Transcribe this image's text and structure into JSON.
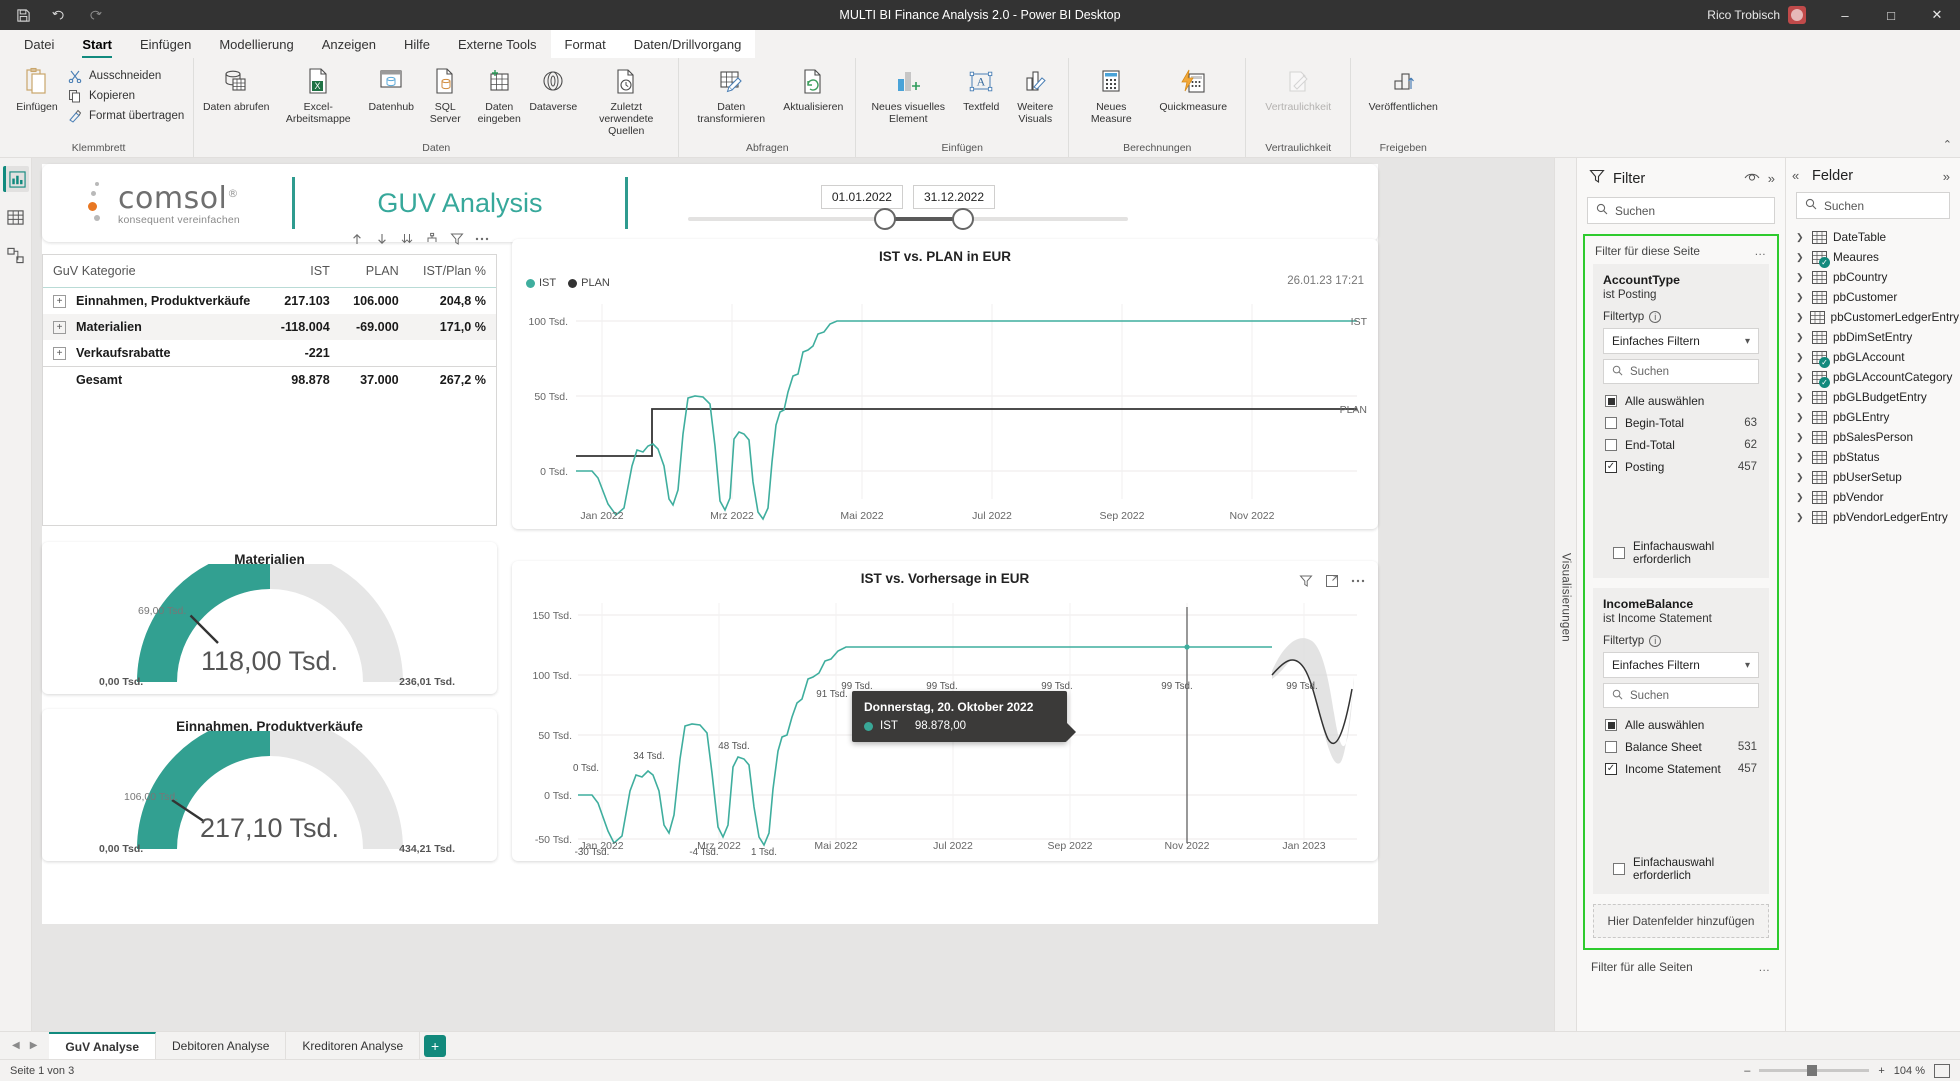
{
  "titlebar": {
    "app_title": "MULTI BI Finance Analysis 2.0 - Power BI Desktop",
    "user": "Rico Trobisch",
    "icons": [
      "save-icon",
      "undo-icon",
      "redo-icon"
    ],
    "window_buttons": {
      "minimize": "–",
      "maximize": "□",
      "close": "✕"
    }
  },
  "menu": {
    "tabs": [
      {
        "label": "Datei",
        "active": false
      },
      {
        "label": "Start",
        "active": true
      },
      {
        "label": "Einfügen",
        "active": false
      },
      {
        "label": "Modellierung",
        "active": false
      },
      {
        "label": "Anzeigen",
        "active": false
      },
      {
        "label": "Hilfe",
        "active": false
      },
      {
        "label": "Externe Tools",
        "active": false
      }
    ],
    "context_tabs": [
      {
        "label": "Format"
      },
      {
        "label": "Daten/Drillvorgang"
      }
    ]
  },
  "ribbon": {
    "groups": [
      {
        "label": "Klemmbrett",
        "paste": "Einfügen",
        "items": [
          {
            "label": "Ausschneiden",
            "icon": "scissors-icon"
          },
          {
            "label": "Kopieren",
            "icon": "copy-icon"
          },
          {
            "label": "Format übertragen",
            "icon": "format-painter-icon"
          }
        ]
      },
      {
        "label": "Daten",
        "items": [
          {
            "label": "Daten abrufen",
            "icon": "get-data-icon",
            "dropdown": true
          },
          {
            "label": "Excel-Arbeitsmappe",
            "icon": "excel-icon"
          },
          {
            "label": "Datenhub",
            "icon": "datahub-icon",
            "dropdown": true
          },
          {
            "label": "SQL Server",
            "icon": "sql-server-icon"
          },
          {
            "label": "Daten eingeben",
            "icon": "enter-data-icon"
          },
          {
            "label": "Dataverse",
            "icon": "dataverse-icon"
          },
          {
            "label": "Zuletzt verwendete Quellen",
            "icon": "recent-sources-icon",
            "dropdown": true
          }
        ]
      },
      {
        "label": "Abfragen",
        "items": [
          {
            "label": "Daten transformieren",
            "icon": "transform-data-icon",
            "dropdown": true
          },
          {
            "label": "Aktualisieren",
            "icon": "refresh-icon"
          }
        ]
      },
      {
        "label": "Einfügen",
        "items": [
          {
            "label": "Neues visuelles Element",
            "icon": "new-visual-icon"
          },
          {
            "label": "Textfeld",
            "icon": "textbox-icon"
          },
          {
            "label": "Weitere Visuals",
            "icon": "more-visuals-icon",
            "dropdown": true
          }
        ]
      },
      {
        "label": "Berechnungen",
        "items": [
          {
            "label": "Neues Measure",
            "icon": "new-measure-icon"
          },
          {
            "label": "Quickmeasure",
            "icon": "quick-measure-icon"
          }
        ]
      },
      {
        "label": "Vertraulichkeit",
        "items": [
          {
            "label": "Vertraulichkeit",
            "icon": "sensitivity-icon",
            "dropdown": true,
            "disabled": true
          }
        ]
      },
      {
        "label": "Freigeben",
        "items": [
          {
            "label": "Veröffentlichen",
            "icon": "publish-icon"
          }
        ]
      }
    ]
  },
  "left_rail": {
    "items": [
      {
        "name": "report-view",
        "icon": "report-icon",
        "active": true
      },
      {
        "name": "data-view",
        "icon": "table-icon",
        "active": false
      },
      {
        "name": "model-view",
        "icon": "model-icon",
        "active": false
      }
    ]
  },
  "report": {
    "logo": {
      "main": "comsol",
      "registered": "®",
      "sub": "konsequent vereinfachen"
    },
    "title": "GUV Analysis",
    "slicer": {
      "start_date": "01.01.2022",
      "end_date": "31.12.2022"
    },
    "matrix": {
      "columns": [
        "GuV Kategorie",
        "IST",
        "PLAN",
        "IST/Plan %"
      ],
      "rows": [
        {
          "label": "Einnahmen, Produktverkäufe",
          "ist": "217.103",
          "plan": "106.000",
          "pct": "204,8 %",
          "expandable": true
        },
        {
          "label": "Materialien",
          "ist": "-118.004",
          "plan": "-69.000",
          "pct": "171,0 %",
          "expandable": true
        },
        {
          "label": "Verkaufsrabatte",
          "ist": "-221",
          "plan": "",
          "pct": "",
          "expandable": true
        },
        {
          "label": "Gesamt",
          "ist": "98.878",
          "plan": "37.000",
          "pct": "267,2 %",
          "expandable": false
        }
      ]
    },
    "gauges": [
      {
        "title": "Materialien",
        "value": "118,00 Tsd.",
        "min": "0,00 Tsd.",
        "max": "236,01 Tsd.",
        "target": "69,00 Tsd.",
        "fill_fraction": 0.4999,
        "target_fraction": 0.2923
      },
      {
        "title": "Einnahmen, Produktverkäufe",
        "value": "217,10 Tsd.",
        "min": "0,00 Tsd.",
        "max": "434,21 Tsd.",
        "target": "106,00 Tsd.",
        "fill_fraction": 0.4999,
        "target_fraction": 0.2441
      }
    ]
  },
  "chart_data": [
    {
      "type": "line",
      "title": "IST vs. PLAN in EUR",
      "timestamp": "26.01.23 17:21",
      "legend": [
        {
          "name": "IST",
          "color": "#3fae9e"
        },
        {
          "name": "PLAN",
          "color": "#333333"
        }
      ],
      "legend_position": "top-left",
      "xlabel": "",
      "ylabel": "",
      "ylim": [
        -20000,
        110000
      ],
      "yticks": [
        "0 Tsd.",
        "50 Tsd.",
        "100 Tsd."
      ],
      "ytick_values": [
        0,
        50000,
        100000
      ],
      "xticks": [
        "Jan 2022",
        "Mrz 2022",
        "Mai 2022",
        "Jul 2022",
        "Sep 2022",
        "Nov 2022"
      ],
      "grid": true,
      "series": [
        {
          "name": "IST",
          "color": "#3fae9e",
          "end_label": "IST",
          "values": [
            0,
            0,
            -2000,
            -30000,
            -18000,
            8000,
            0,
            12000,
            -4000,
            46000,
            48000,
            1000,
            0,
            -20000,
            28000,
            60000,
            70000,
            78000,
            96000,
            99000,
            99000,
            99000,
            99000,
            99000,
            99000,
            99000,
            99000,
            99000,
            99000,
            99000,
            99000,
            99000
          ]
        },
        {
          "name": "PLAN",
          "color": "#333333",
          "end_label": "PLAN",
          "values": [
            10000,
            10000,
            10000,
            10000,
            37000,
            37000,
            37000,
            37000,
            37000,
            37000,
            37000,
            37000,
            37000,
            37000,
            37000,
            37000,
            37000,
            37000,
            37000,
            37000,
            37000,
            37000,
            37000,
            37000,
            37000,
            37000,
            37000,
            37000,
            37000,
            37000,
            37000,
            37000
          ]
        }
      ]
    },
    {
      "type": "line",
      "title": "IST vs. Vorhersage in EUR",
      "xlabel": "",
      "ylabel": "",
      "ylim": [
        -60000,
        160000
      ],
      "yticks": [
        "-50 Tsd.",
        "0 Tsd.",
        "50 Tsd.",
        "100 Tsd.",
        "150 Tsd."
      ],
      "ytick_values": [
        -50000,
        0,
        50000,
        100000,
        150000
      ],
      "xticks": [
        "Jan 2022",
        "Mrz 2022",
        "Mai 2022",
        "Jul 2022",
        "Sep 2022",
        "Nov 2022",
        "Jan 2023"
      ],
      "grid": true,
      "data_labels": [
        "0 Tsd.",
        "-30 Tsd.",
        "34 Tsd.",
        "-4 Tsd.",
        "48 Tsd.",
        "1 Tsd.",
        "91 Tsd.",
        "99 Tsd.",
        "99 Tsd.",
        "99 Tsd.",
        "99 Tsd.",
        "99 Tsd."
      ],
      "forecast_band": true,
      "series": [
        {
          "name": "IST",
          "color": "#3fae9e",
          "values": [
            0,
            0,
            -10000,
            -30000,
            -14000,
            10000,
            2000,
            34000,
            -4000,
            48000,
            44000,
            1000,
            -2000,
            20000,
            48000,
            62000,
            78000,
            91000,
            99000,
            99000,
            99000,
            99000,
            99000,
            99000,
            99000,
            99000,
            99000,
            99000
          ]
        },
        {
          "name": "Vorhersage",
          "color": "#333333",
          "values": [
            99000,
            99000,
            60000,
            85000,
            110000,
            99000
          ]
        }
      ],
      "tooltip": {
        "title": "Donnerstag, 20. Oktober 2022",
        "series_name": "IST",
        "value": "98.878,00",
        "dot_color": "#3fae9e"
      },
      "toolbar_icons": [
        "filter-icon",
        "focus-mode-icon",
        "more-options-icon"
      ]
    }
  ],
  "visualizations_strip": {
    "label": "Visualisierungen"
  },
  "filter_pane": {
    "title": "Filter",
    "search_placeholder": "Suchen",
    "header_icons": [
      "eye-icon",
      "collapse-pane-icon"
    ],
    "section_label": "Filter für diese Seite",
    "cards": [
      {
        "name": "AccountType",
        "condition": "ist Posting",
        "filter_type_label": "Filtertyp",
        "filter_type_value": "Einfaches Filtern",
        "search_placeholder": "Suchen",
        "select_all_label": "Alle auswählen",
        "select_all_state": "partial",
        "items": [
          {
            "label": "Begin-Total",
            "count": "63",
            "checked": false
          },
          {
            "label": "End-Total",
            "count": "62",
            "checked": false
          },
          {
            "label": "Posting",
            "count": "457",
            "checked": true
          }
        ],
        "single_select_label": "Einfachauswahl erforderlich",
        "single_select_checked": false
      },
      {
        "name": "IncomeBalance",
        "condition": "ist Income Statement",
        "filter_type_label": "Filtertyp",
        "filter_type_value": "Einfaches Filtern",
        "search_placeholder": "Suchen",
        "select_all_label": "Alle auswählen",
        "select_all_state": "partial",
        "items": [
          {
            "label": "Balance Sheet",
            "count": "531",
            "checked": false
          },
          {
            "label": "Income Statement",
            "count": "457",
            "checked": true
          }
        ],
        "single_select_label": "Einfachauswahl erforderlich",
        "single_select_checked": false
      }
    ],
    "drop_zone": "Hier Datenfelder hinzufügen",
    "all_pages_label": "Filter für alle Seiten"
  },
  "fields_pane": {
    "title": "Felder",
    "search_placeholder": "Suchen",
    "items": [
      {
        "label": "DateTable",
        "checked": false
      },
      {
        "label": "Meaures",
        "checked": true
      },
      {
        "label": "pbCountry",
        "checked": false
      },
      {
        "label": "pbCustomer",
        "checked": false
      },
      {
        "label": "pbCustomerLedgerEntry",
        "checked": false
      },
      {
        "label": "pbDimSetEntry",
        "checked": false
      },
      {
        "label": "pbGLAccount",
        "checked": true
      },
      {
        "label": "pbGLAccountCategory",
        "checked": true
      },
      {
        "label": "pbGLBudgetEntry",
        "checked": false
      },
      {
        "label": "pbGLEntry",
        "checked": false
      },
      {
        "label": "pbSalesPerson",
        "checked": false
      },
      {
        "label": "pbStatus",
        "checked": false
      },
      {
        "label": "pbUserSetup",
        "checked": false
      },
      {
        "label": "pbVendor",
        "checked": false
      },
      {
        "label": "pbVendorLedgerEntry",
        "checked": false
      }
    ]
  },
  "page_tabs": {
    "tabs": [
      {
        "label": "GuV Analyse",
        "active": true
      },
      {
        "label": "Debitoren Analyse",
        "active": false
      },
      {
        "label": "Kreditoren Analyse",
        "active": false
      }
    ],
    "add_label": "+"
  },
  "status_bar": {
    "page_info": "Seite 1 von 3",
    "zoom": "104 %",
    "zoom_minus": "–",
    "zoom_plus": "+"
  }
}
